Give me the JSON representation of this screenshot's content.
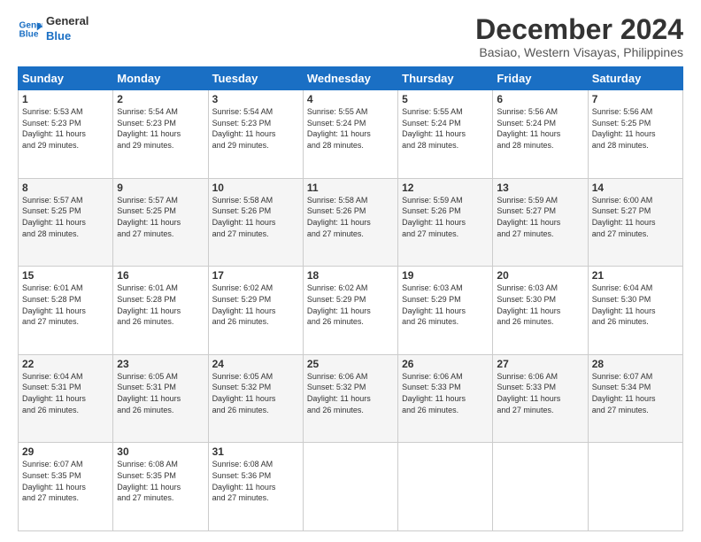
{
  "logo": {
    "line1": "General",
    "line2": "Blue"
  },
  "title": "December 2024",
  "subtitle": "Basiao, Western Visayas, Philippines",
  "days_of_week": [
    "Sunday",
    "Monday",
    "Tuesday",
    "Wednesday",
    "Thursday",
    "Friday",
    "Saturday"
  ],
  "weeks": [
    [
      {
        "day": 1,
        "info": "Sunrise: 5:53 AM\nSunset: 5:23 PM\nDaylight: 11 hours\nand 29 minutes."
      },
      {
        "day": 2,
        "info": "Sunrise: 5:54 AM\nSunset: 5:23 PM\nDaylight: 11 hours\nand 29 minutes."
      },
      {
        "day": 3,
        "info": "Sunrise: 5:54 AM\nSunset: 5:23 PM\nDaylight: 11 hours\nand 29 minutes."
      },
      {
        "day": 4,
        "info": "Sunrise: 5:55 AM\nSunset: 5:24 PM\nDaylight: 11 hours\nand 28 minutes."
      },
      {
        "day": 5,
        "info": "Sunrise: 5:55 AM\nSunset: 5:24 PM\nDaylight: 11 hours\nand 28 minutes."
      },
      {
        "day": 6,
        "info": "Sunrise: 5:56 AM\nSunset: 5:24 PM\nDaylight: 11 hours\nand 28 minutes."
      },
      {
        "day": 7,
        "info": "Sunrise: 5:56 AM\nSunset: 5:25 PM\nDaylight: 11 hours\nand 28 minutes."
      }
    ],
    [
      {
        "day": 8,
        "info": "Sunrise: 5:57 AM\nSunset: 5:25 PM\nDaylight: 11 hours\nand 28 minutes."
      },
      {
        "day": 9,
        "info": "Sunrise: 5:57 AM\nSunset: 5:25 PM\nDaylight: 11 hours\nand 27 minutes."
      },
      {
        "day": 10,
        "info": "Sunrise: 5:58 AM\nSunset: 5:26 PM\nDaylight: 11 hours\nand 27 minutes."
      },
      {
        "day": 11,
        "info": "Sunrise: 5:58 AM\nSunset: 5:26 PM\nDaylight: 11 hours\nand 27 minutes."
      },
      {
        "day": 12,
        "info": "Sunrise: 5:59 AM\nSunset: 5:26 PM\nDaylight: 11 hours\nand 27 minutes."
      },
      {
        "day": 13,
        "info": "Sunrise: 5:59 AM\nSunset: 5:27 PM\nDaylight: 11 hours\nand 27 minutes."
      },
      {
        "day": 14,
        "info": "Sunrise: 6:00 AM\nSunset: 5:27 PM\nDaylight: 11 hours\nand 27 minutes."
      }
    ],
    [
      {
        "day": 15,
        "info": "Sunrise: 6:01 AM\nSunset: 5:28 PM\nDaylight: 11 hours\nand 27 minutes."
      },
      {
        "day": 16,
        "info": "Sunrise: 6:01 AM\nSunset: 5:28 PM\nDaylight: 11 hours\nand 26 minutes."
      },
      {
        "day": 17,
        "info": "Sunrise: 6:02 AM\nSunset: 5:29 PM\nDaylight: 11 hours\nand 26 minutes."
      },
      {
        "day": 18,
        "info": "Sunrise: 6:02 AM\nSunset: 5:29 PM\nDaylight: 11 hours\nand 26 minutes."
      },
      {
        "day": 19,
        "info": "Sunrise: 6:03 AM\nSunset: 5:29 PM\nDaylight: 11 hours\nand 26 minutes."
      },
      {
        "day": 20,
        "info": "Sunrise: 6:03 AM\nSunset: 5:30 PM\nDaylight: 11 hours\nand 26 minutes."
      },
      {
        "day": 21,
        "info": "Sunrise: 6:04 AM\nSunset: 5:30 PM\nDaylight: 11 hours\nand 26 minutes."
      }
    ],
    [
      {
        "day": 22,
        "info": "Sunrise: 6:04 AM\nSunset: 5:31 PM\nDaylight: 11 hours\nand 26 minutes."
      },
      {
        "day": 23,
        "info": "Sunrise: 6:05 AM\nSunset: 5:31 PM\nDaylight: 11 hours\nand 26 minutes."
      },
      {
        "day": 24,
        "info": "Sunrise: 6:05 AM\nSunset: 5:32 PM\nDaylight: 11 hours\nand 26 minutes."
      },
      {
        "day": 25,
        "info": "Sunrise: 6:06 AM\nSunset: 5:32 PM\nDaylight: 11 hours\nand 26 minutes."
      },
      {
        "day": 26,
        "info": "Sunrise: 6:06 AM\nSunset: 5:33 PM\nDaylight: 11 hours\nand 26 minutes."
      },
      {
        "day": 27,
        "info": "Sunrise: 6:06 AM\nSunset: 5:33 PM\nDaylight: 11 hours\nand 27 minutes."
      },
      {
        "day": 28,
        "info": "Sunrise: 6:07 AM\nSunset: 5:34 PM\nDaylight: 11 hours\nand 27 minutes."
      }
    ],
    [
      {
        "day": 29,
        "info": "Sunrise: 6:07 AM\nSunset: 5:35 PM\nDaylight: 11 hours\nand 27 minutes."
      },
      {
        "day": 30,
        "info": "Sunrise: 6:08 AM\nSunset: 5:35 PM\nDaylight: 11 hours\nand 27 minutes."
      },
      {
        "day": 31,
        "info": "Sunrise: 6:08 AM\nSunset: 5:36 PM\nDaylight: 11 hours\nand 27 minutes."
      },
      null,
      null,
      null,
      null
    ]
  ]
}
